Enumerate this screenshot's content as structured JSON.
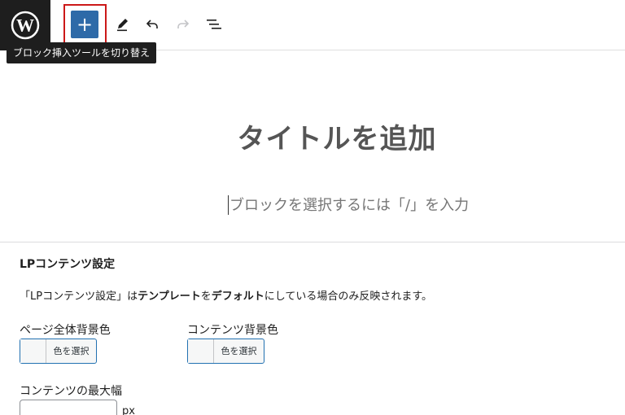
{
  "toolbar": {
    "inserter_label": "+",
    "tooltip": "ブロック挿入ツールを切り替え",
    "icons": [
      "wordpress-icon",
      "plus-icon",
      "pencil-icon",
      "undo-icon",
      "redo-icon",
      "list-view-icon"
    ]
  },
  "editor": {
    "title_placeholder": "タイトルを追加",
    "block_placeholder": "ブロックを選択するには「/」を入力"
  },
  "settings": {
    "panel_title": "LPコンテンツ設定",
    "notice_pre": "「LPコンテンツ設定」は",
    "notice_bold1": "テンプレート",
    "notice_mid": "を",
    "notice_bold2": "デフォルト",
    "notice_post": "にしている場合のみ反映されます。",
    "page_bg_label": "ページ全体背景色",
    "content_bg_label": "コンテンツ背景色",
    "select_color": "色を選択",
    "max_width_label": "コンテンツの最大幅",
    "max_width_value": "",
    "unit": "px"
  },
  "colors": {
    "inserter_bg": "#2e6aa8",
    "highlight_border": "#cc1818",
    "logo_bg": "#1e1e1e"
  }
}
